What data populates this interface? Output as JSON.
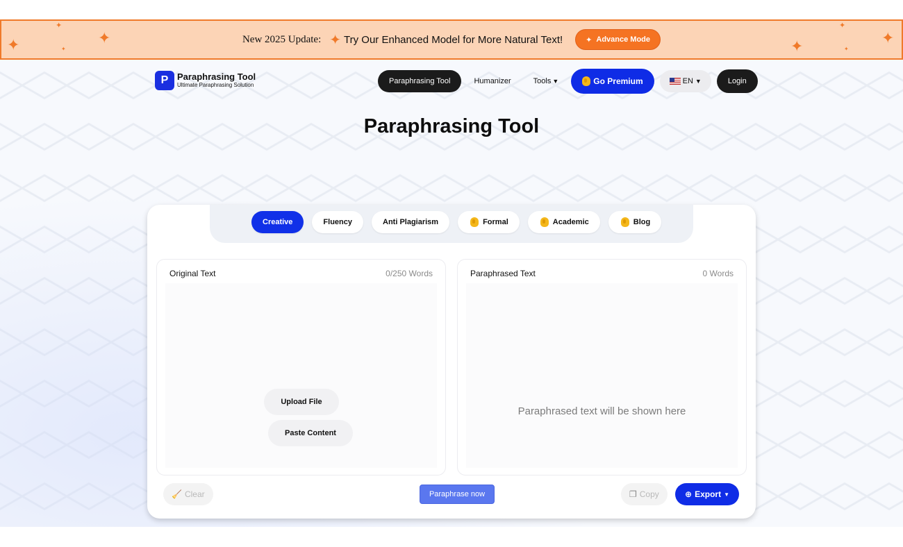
{
  "banner": {
    "update_label": "New 2025 Update:",
    "message": "Try Our Enhanced Model for More Natural Text!",
    "button_label": "Advance Mode",
    "icon": "sparkle-icon",
    "color_bg": "#fcd4b6",
    "color_accent": "#f57322"
  },
  "header": {
    "logo_title": "Paraphrasing Tool",
    "logo_subtitle": "Ultimate Paraphrasing Solution",
    "nav_active": "Paraphrasing Tool",
    "nav_humanizer": "Humanizer",
    "nav_tools": "Tools",
    "premium_label": "Go Premium",
    "lang_label": "EN",
    "login_label": "Login"
  },
  "page_title": "Paraphrasing Tool",
  "modes": [
    {
      "label": "Creative",
      "active": true,
      "premium": false
    },
    {
      "label": "Fluency",
      "active": false,
      "premium": false
    },
    {
      "label": "Anti Plagiarism",
      "active": false,
      "premium": false
    },
    {
      "label": "Formal",
      "active": false,
      "premium": true
    },
    {
      "label": "Academic",
      "active": false,
      "premium": true
    },
    {
      "label": "Blog",
      "active": false,
      "premium": true
    }
  ],
  "original": {
    "title": "Original Text",
    "count": "0/250 Words",
    "upload_label": "Upload File",
    "paste_label": "Paste Content"
  },
  "paraphrased": {
    "title": "Paraphrased Text",
    "count": "0 Words",
    "placeholder": "Paraphrased text will be shown here"
  },
  "actions": {
    "clear_label": "Clear",
    "paraphrase_label": "Paraphrase now",
    "copy_label": "Copy",
    "export_label": "Export"
  },
  "colors": {
    "primary_blue": "#0f2ce6",
    "dark_pill": "#1b1b1b"
  }
}
